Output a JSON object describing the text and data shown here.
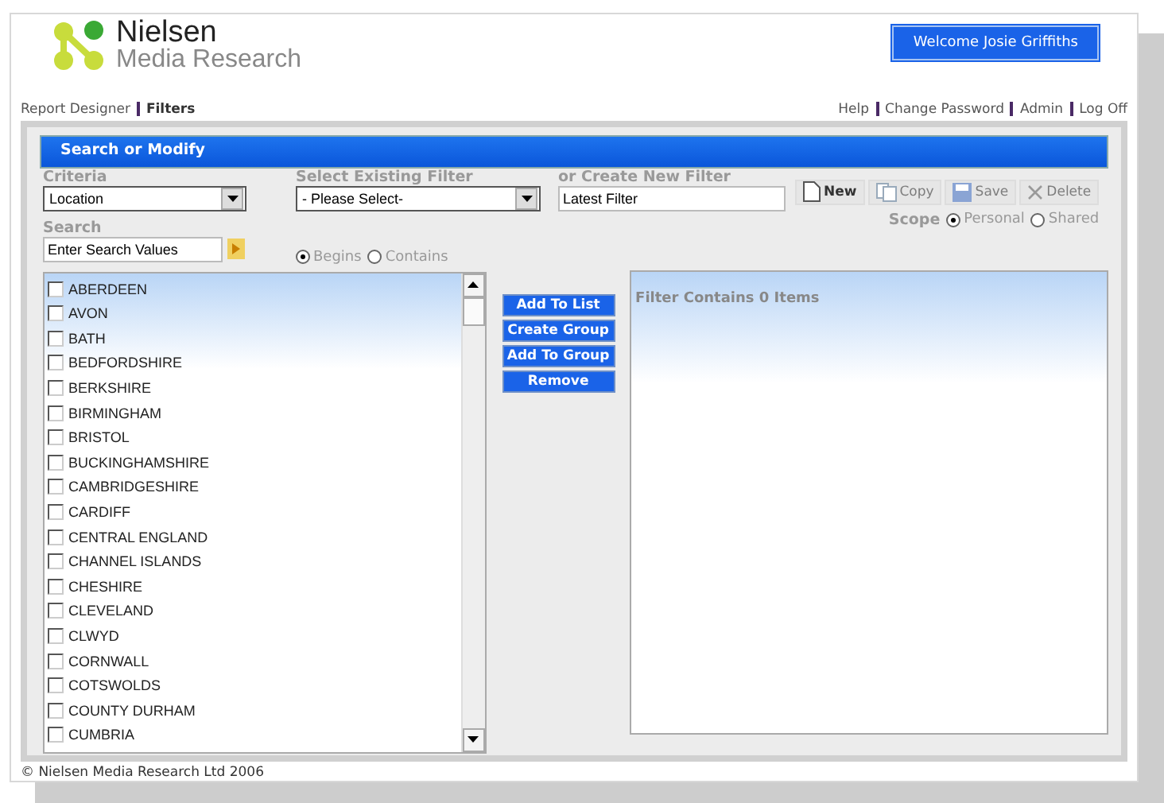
{
  "logo": {
    "name": "Nielsen",
    "subtitle": "Media Research"
  },
  "welcome": "Welcome Josie Griffiths",
  "nav": [
    {
      "label": "Report Designer",
      "selected": false
    },
    {
      "label": "Filters",
      "selected": true
    }
  ],
  "top_links": [
    "Help",
    "Change Password",
    "Admin",
    "Log Off"
  ],
  "panel": {
    "title": "Search or Modify",
    "criteria": {
      "label": "Criteria",
      "value": "Location"
    },
    "existing_filter": {
      "label": "Select Existing Filter",
      "value": "- Please Select-"
    },
    "new_filter": {
      "label": "or Create New Filter",
      "value": "Latest Filter"
    },
    "toolbar": [
      {
        "label": "New",
        "kind": "new",
        "disabled": false
      },
      {
        "label": "Copy",
        "kind": "copy",
        "disabled": true
      },
      {
        "label": "Save",
        "kind": "save",
        "disabled": true
      },
      {
        "label": "Delete",
        "kind": "delete",
        "disabled": true
      }
    ],
    "scope": {
      "label": "Scope",
      "options": [
        {
          "label": "Personal",
          "selected": true
        },
        {
          "label": "Shared",
          "selected": false
        }
      ]
    },
    "search": {
      "label": "Search",
      "value": "Enter Search Values"
    },
    "match": [
      {
        "label": "Begins",
        "selected": true
      },
      {
        "label": "Contains",
        "selected": false
      }
    ],
    "items": [
      {
        "label": "ABERDEEN",
        "checked": false
      },
      {
        "label": "AVON",
        "checked": false
      },
      {
        "label": "BATH",
        "checked": false
      },
      {
        "label": "BEDFORDSHIRE",
        "checked": false
      },
      {
        "label": "BERKSHIRE",
        "checked": false
      },
      {
        "label": "BIRMINGHAM",
        "checked": false
      },
      {
        "label": "BRISTOL",
        "checked": false
      },
      {
        "label": "BUCKINGHAMSHIRE",
        "checked": false
      },
      {
        "label": "CAMBRIDGESHIRE",
        "checked": false
      },
      {
        "label": "CARDIFF",
        "checked": false
      },
      {
        "label": "CENTRAL ENGLAND",
        "checked": false
      },
      {
        "label": "CHANNEL ISLANDS",
        "checked": false
      },
      {
        "label": "CHESHIRE",
        "checked": false
      },
      {
        "label": "CLEVELAND",
        "checked": false
      },
      {
        "label": "CLWYD",
        "checked": false
      },
      {
        "label": "CORNWALL",
        "checked": false
      },
      {
        "label": "COTSWOLDS",
        "checked": false
      },
      {
        "label": "COUNTY DURHAM",
        "checked": false
      },
      {
        "label": "CUMBRIA",
        "checked": false
      }
    ],
    "actions": [
      "Add To List",
      "Create Group",
      "Add To Group",
      "Remove"
    ],
    "filter_title": "Filter Contains 0 Items"
  },
  "footer": "© Nielsen Media Research Ltd 2006"
}
